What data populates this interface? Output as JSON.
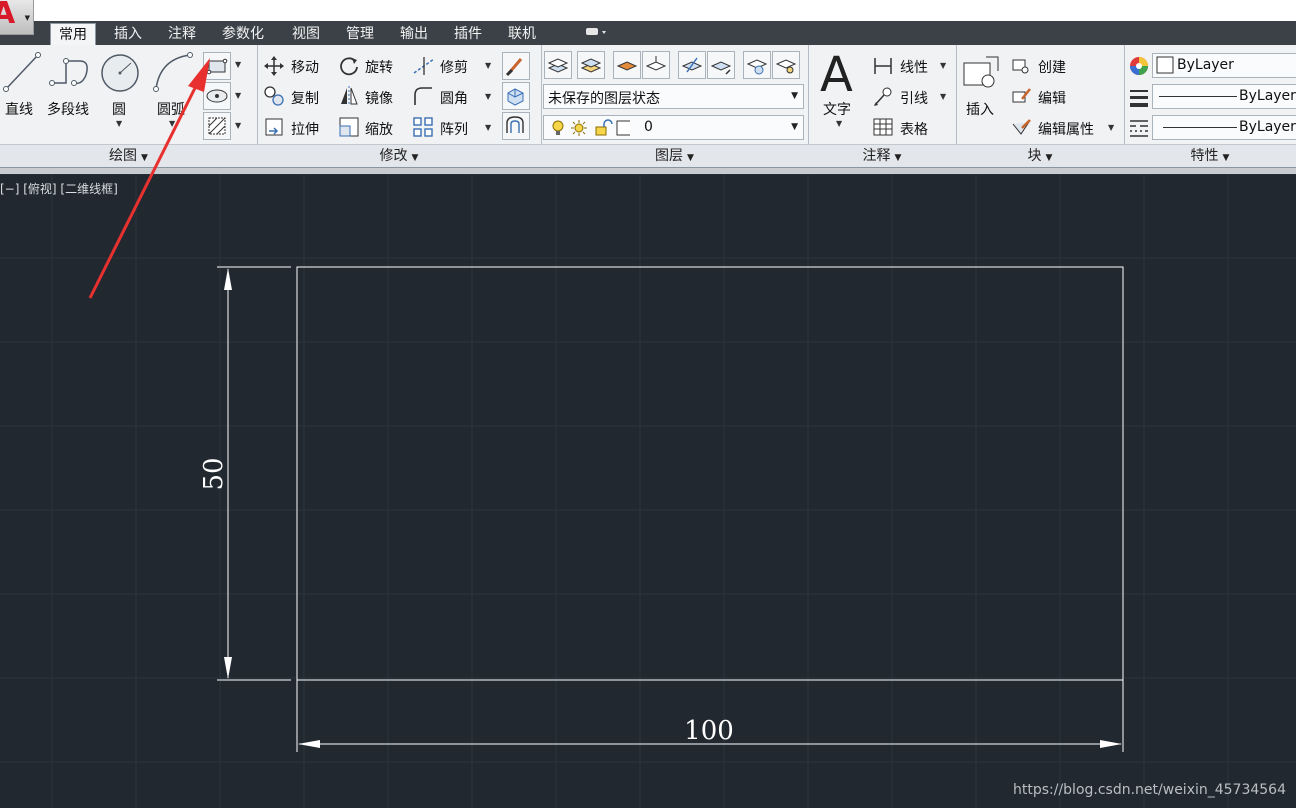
{
  "app": {
    "logo_letter": "A"
  },
  "tabs": [
    "常用",
    "插入",
    "注释",
    "参数化",
    "视图",
    "管理",
    "输出",
    "插件",
    "联机"
  ],
  "panels": {
    "draw": {
      "title": "绘图",
      "tools": [
        "直线",
        "多段线",
        "圆",
        "圆弧"
      ]
    },
    "modify": {
      "title": "修改",
      "tools": [
        "移动",
        "旋转",
        "修剪",
        "复制",
        "镜像",
        "圆角",
        "拉伸",
        "缩放",
        "阵列"
      ]
    },
    "layers": {
      "title": "图层",
      "state": "未保存的图层状态",
      "current_layer": "0"
    },
    "annotation": {
      "title": "注释",
      "text": "文字",
      "linear": "线性",
      "leader": "引线",
      "table": "表格"
    },
    "block": {
      "title": "块",
      "insert": "插入",
      "create": "创建",
      "edit": "编辑",
      "edit_attr": "编辑属性"
    },
    "properties": {
      "title": "特性",
      "color": "ByLayer",
      "linetype": "ByLayer",
      "lineweight": "ByLayer"
    }
  },
  "viewport": {
    "label": "[−] [俯视] [二维线框]"
  },
  "drawing": {
    "rect_width": 100,
    "rect_height": 50,
    "dim_width": "100",
    "dim_height": "50"
  },
  "watermark": "https://blog.csdn.net/weixin_45734564",
  "colors": {
    "canvas": "#212830",
    "annotation_arrow": "#e8312f",
    "drawing_line": "#ffffff"
  }
}
